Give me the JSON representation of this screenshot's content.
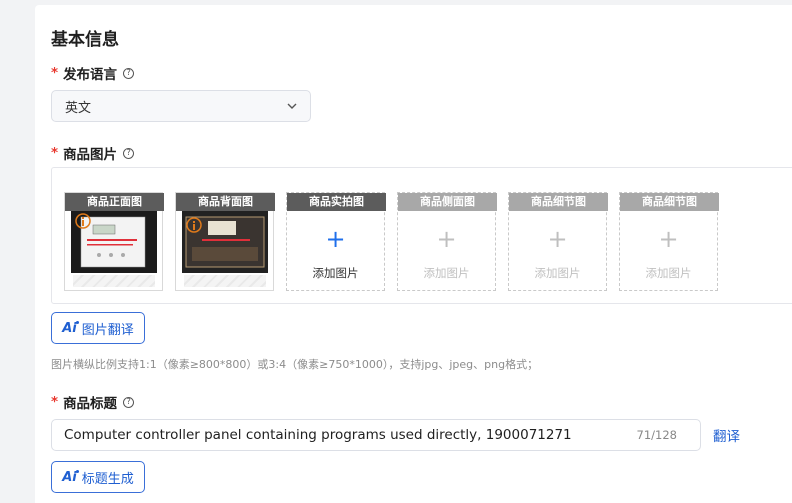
{
  "section": {
    "title": "基本信息"
  },
  "language": {
    "required_mark": "*",
    "label": "发布语言",
    "help_glyph": "?",
    "selected_value": "英文",
    "icon": "chevron-down-icon"
  },
  "images": {
    "required_mark": "*",
    "label": "商品图片",
    "help_glyph": "?",
    "slots": [
      {
        "tag": "商品正面图",
        "state": "filled"
      },
      {
        "tag": "商品背面图",
        "state": "filled"
      },
      {
        "tag": "商品实拍图",
        "state": "empty-active",
        "plus": "+",
        "add_label": "添加图片"
      },
      {
        "tag": "商品侧面图",
        "state": "empty-disabled",
        "plus": "+",
        "add_label": "添加图片"
      },
      {
        "tag": "商品细节图",
        "state": "empty-disabled",
        "plus": "+",
        "add_label": "添加图片"
      },
      {
        "tag": "商品细节图",
        "state": "empty-disabled",
        "plus": "+",
        "add_label": "添加图片"
      }
    ],
    "translate_button": {
      "ai_glyph": "Ai",
      "label": "图片翻译"
    },
    "hint": "图片横纵比例支持1:1（像素≥800*800）或3:4（像素≥750*1000），支持jpg、jpeg、png格式；"
  },
  "product_title": {
    "required_mark": "*",
    "label": "商品标题",
    "help_glyph": "?",
    "value": "Computer controller panel containing programs used directly, 1900071271",
    "char_count": "71/128",
    "translate_link": "翻译",
    "generate_button": {
      "ai_glyph": "Ai",
      "label": "标题生成"
    }
  },
  "colors": {
    "accent": "#1f5fd1",
    "required": "#e8382f",
    "hint_text": "#8c8c8c"
  }
}
